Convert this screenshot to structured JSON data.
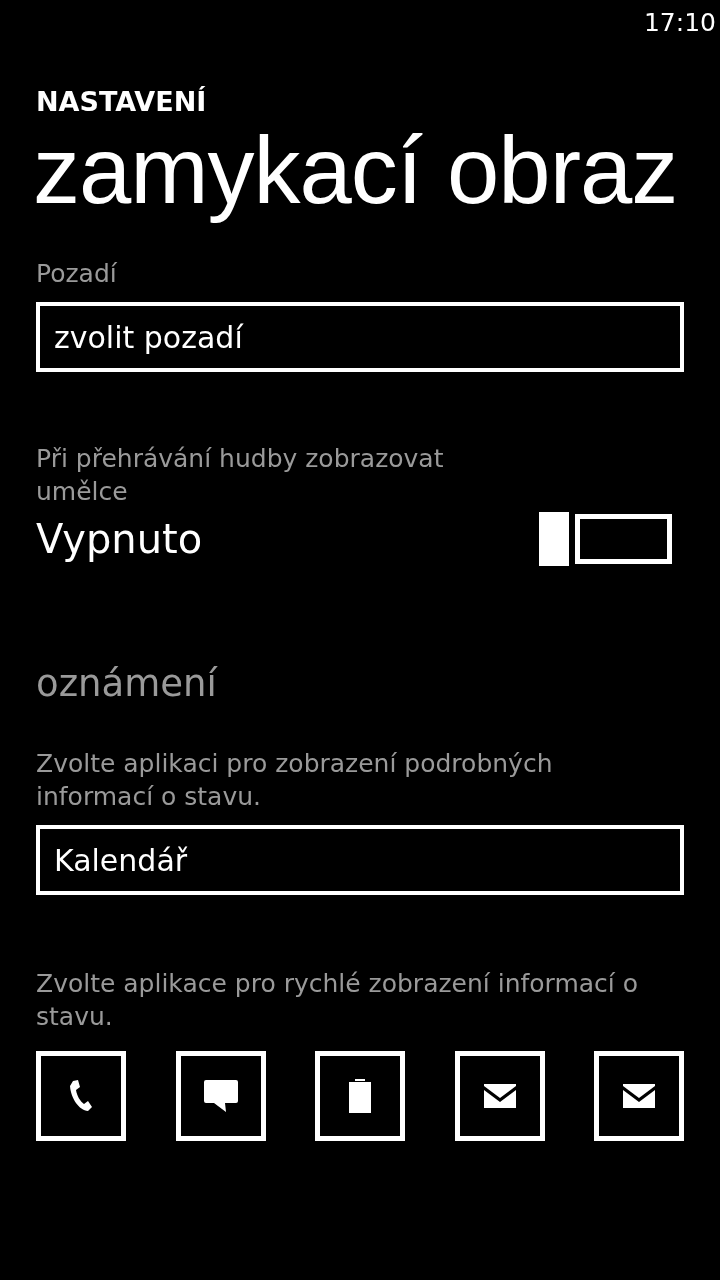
{
  "status_bar": {
    "time": "17:10"
  },
  "header": {
    "app": "NASTAVENÍ",
    "title": "zamykací obraz"
  },
  "background": {
    "label": "Pozadí",
    "value": "zvolit pozadí"
  },
  "artist_toggle": {
    "label": "Při přehrávání hudby zobrazovat umělce",
    "state_text": "Vypnuto",
    "on": false
  },
  "notifications": {
    "heading": "oznámení",
    "detailed": {
      "label": "Zvolte aplikaci pro zobrazení podrobných informací o stavu.",
      "value": "Kalendář"
    },
    "quick": {
      "label": "Zvolte aplikace pro rychlé zobrazení informací o stavu.",
      "slots": [
        {
          "kind": "phone"
        },
        {
          "kind": "message"
        },
        {
          "kind": "battery"
        },
        {
          "kind": "mail"
        },
        {
          "kind": "mail"
        }
      ]
    }
  }
}
